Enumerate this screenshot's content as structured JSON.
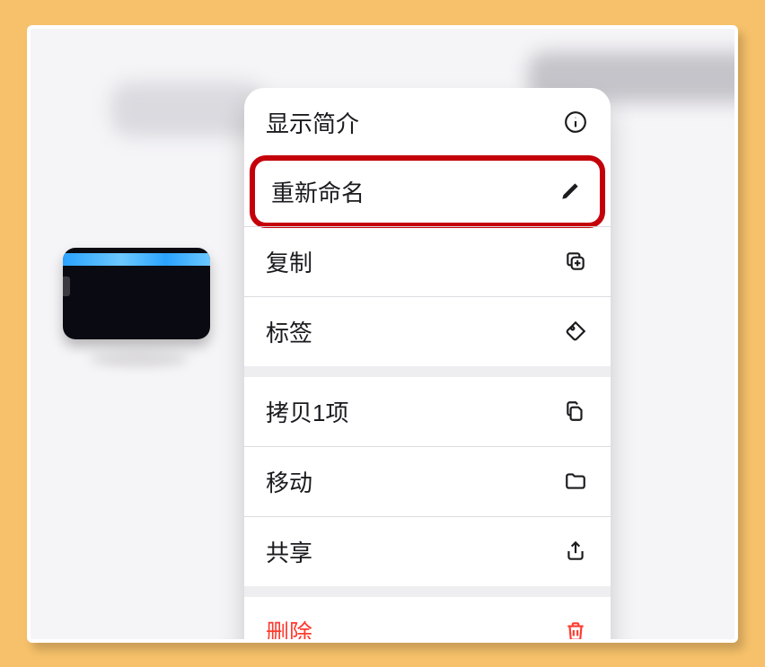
{
  "menu": {
    "info": {
      "label": "显示简介"
    },
    "rename": {
      "label": "重新命名"
    },
    "duplicate": {
      "label": "复制"
    },
    "tags": {
      "label": "标签"
    },
    "copy": {
      "label": "拷贝1项"
    },
    "move": {
      "label": "移动"
    },
    "share": {
      "label": "共享"
    },
    "delete": {
      "label": "删除"
    }
  }
}
